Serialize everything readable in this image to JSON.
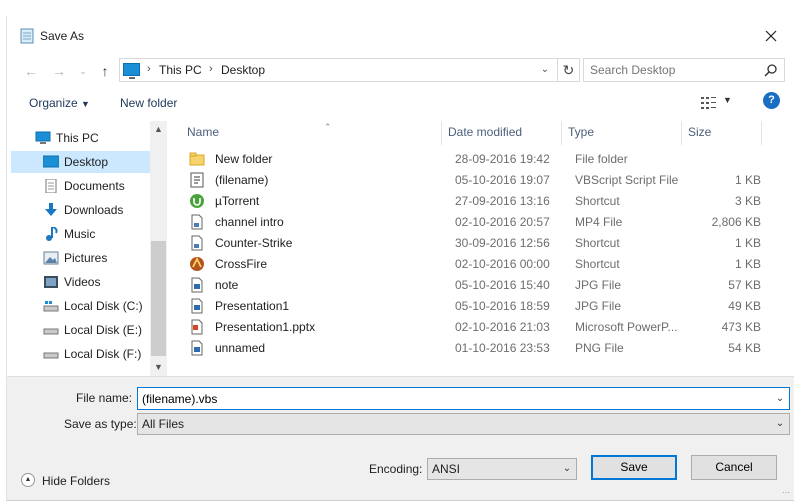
{
  "window": {
    "title": "Save As"
  },
  "address": {
    "crumbs": [
      "This PC",
      "Desktop"
    ],
    "search_placeholder": "Search Desktop"
  },
  "toolbar": {
    "organize_label": "Organize",
    "new_folder_label": "New folder"
  },
  "nav_pane": {
    "items": [
      {
        "label": "This PC",
        "icon": "computer-icon"
      },
      {
        "label": "Desktop",
        "icon": "desktop-icon",
        "selected": true
      },
      {
        "label": "Documents",
        "icon": "documents-icon"
      },
      {
        "label": "Downloads",
        "icon": "downloads-icon"
      },
      {
        "label": "Music",
        "icon": "music-icon"
      },
      {
        "label": "Pictures",
        "icon": "pictures-icon"
      },
      {
        "label": "Videos",
        "icon": "videos-icon"
      },
      {
        "label": "Local Disk (C:)",
        "icon": "drive-icon"
      },
      {
        "label": "Local Disk (E:)",
        "icon": "drive-icon"
      },
      {
        "label": "Local Disk (F:)",
        "icon": "drive-icon"
      }
    ]
  },
  "file_list": {
    "columns": [
      "Name",
      "Date modified",
      "Type",
      "Size"
    ],
    "rows": [
      {
        "name": "New folder",
        "date": "28-09-2016 19:42",
        "type": "File folder",
        "size": "",
        "icon": "folder-icon"
      },
      {
        "name": "(filename)",
        "date": "05-10-2016 19:07",
        "type": "VBScript Script File",
        "size": "1 KB",
        "icon": "script-icon"
      },
      {
        "name": "µTorrent",
        "date": "27-09-2016 13:16",
        "type": "Shortcut",
        "size": "3 KB",
        "icon": "utorrent-icon"
      },
      {
        "name": "channel intro",
        "date": "02-10-2016 20:57",
        "type": "MP4 File",
        "size": "2,806 KB",
        "icon": "file-icon"
      },
      {
        "name": "Counter-Strike",
        "date": "30-09-2016 12:56",
        "type": "Shortcut",
        "size": "1 KB",
        "icon": "file-icon"
      },
      {
        "name": "CrossFire",
        "date": "02-10-2016 00:00",
        "type": "Shortcut",
        "size": "1 KB",
        "icon": "crossfire-icon"
      },
      {
        "name": "note",
        "date": "05-10-2016 15:40",
        "type": "JPG File",
        "size": "57 KB",
        "icon": "image-file-icon"
      },
      {
        "name": "Presentation1",
        "date": "05-10-2016 18:59",
        "type": "JPG File",
        "size": "49 KB",
        "icon": "image-file-icon"
      },
      {
        "name": "Presentation1.pptx",
        "date": "02-10-2016 21:03",
        "type": "Microsoft PowerP...",
        "size": "473 KB",
        "icon": "pptx-icon"
      },
      {
        "name": "unnamed",
        "date": "01-10-2016 23:53",
        "type": "PNG File",
        "size": "54 KB",
        "icon": "image-file-icon"
      }
    ]
  },
  "save_panel": {
    "file_name_label": "File name:",
    "file_name_value": "(filename).vbs",
    "save_as_type_label": "Save as type:",
    "save_as_type_value": "All Files",
    "hide_folders_label": "Hide Folders",
    "encoding_label": "Encoding:",
    "encoding_value": "ANSI",
    "save_label": "Save",
    "cancel_label": "Cancel"
  },
  "colors": {
    "accent": "#0078d7",
    "selection": "#cce8ff",
    "panel": "#f0f0f0",
    "help": "#1b6ec2"
  }
}
